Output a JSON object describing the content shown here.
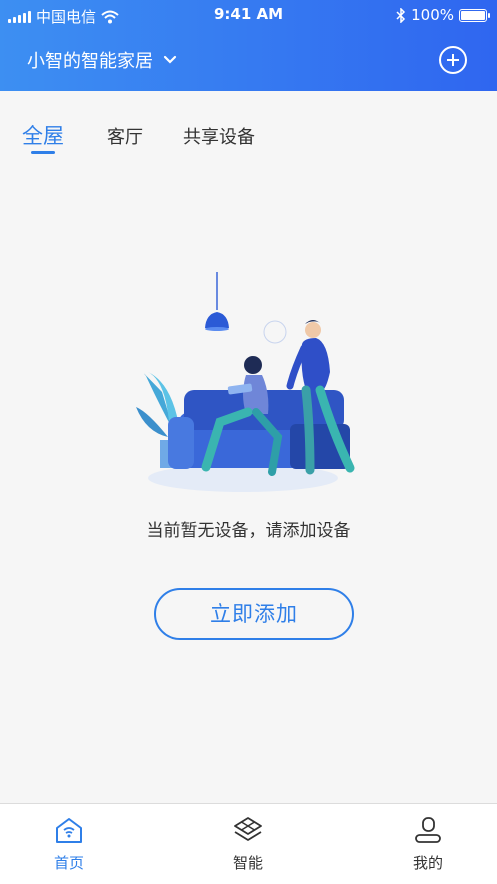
{
  "status_bar": {
    "carrier": "中国电信",
    "time": "9:41 AM",
    "battery": "100%"
  },
  "header": {
    "home_name": "小智的智能家居"
  },
  "tabs": [
    {
      "label": "全屋",
      "active": true
    },
    {
      "label": "客厅",
      "active": false
    },
    {
      "label": "共享设备",
      "active": false
    }
  ],
  "empty_state": {
    "message": "当前暂无设备，请添加设备",
    "button_label": "立即添加"
  },
  "tabbar": [
    {
      "label": "首页",
      "icon": "home-icon",
      "active": true
    },
    {
      "label": "智能",
      "icon": "smart-icon",
      "active": false
    },
    {
      "label": "我的",
      "icon": "profile-icon",
      "active": false
    }
  ],
  "colors": {
    "accent": "#2f7fe8",
    "header_start": "#3d8ff2",
    "header_end": "#2f66f0"
  }
}
